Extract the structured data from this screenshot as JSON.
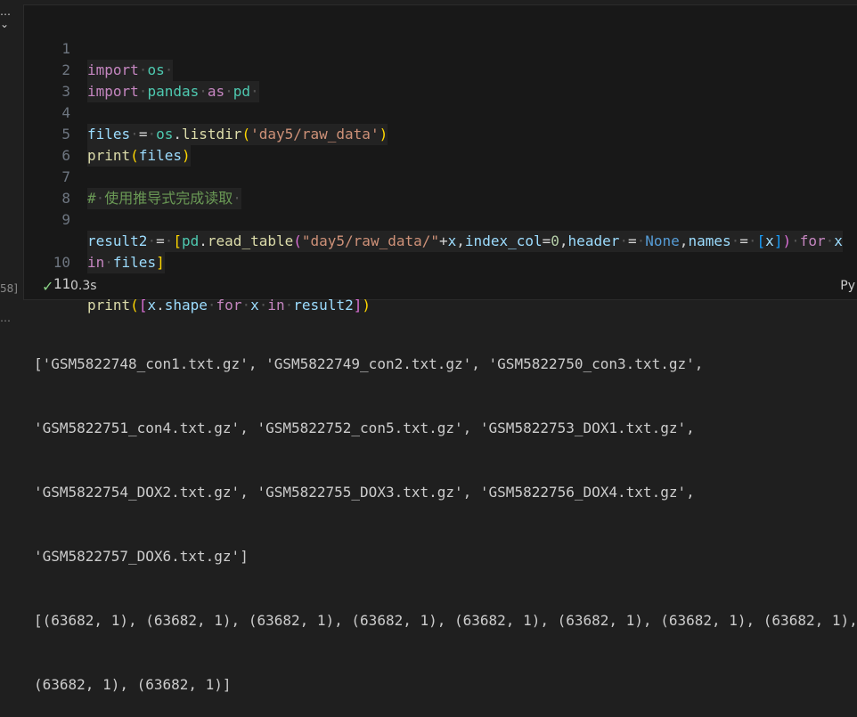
{
  "gutter": {
    "chevron": "… ⌄",
    "exec_count": "58]",
    "out_marker": "…"
  },
  "cell": {
    "lines": [
      {
        "n": "1",
        "text": "import os"
      },
      {
        "n": "2",
        "text": "import pandas as pd"
      },
      {
        "n": "3",
        "text": ""
      },
      {
        "n": "4",
        "text": "files = os.listdir('day5/raw_data')"
      },
      {
        "n": "5",
        "text": "print(files)"
      },
      {
        "n": "6",
        "text": ""
      },
      {
        "n": "7",
        "text": "# 使用推导式完成读取"
      },
      {
        "n": "8",
        "text": ""
      },
      {
        "n": "9",
        "text": "result2 = [pd.read_table(\"day5/raw_data/\"+x,index_col=0,header = None,names = [x]) for x"
      },
      {
        "n": "",
        "text": "in files]"
      },
      {
        "n": "10",
        "text": ""
      },
      {
        "n": "11",
        "text": "print([x.shape for x in result2])"
      }
    ],
    "status": {
      "time": "0.3s",
      "language": "Py"
    }
  },
  "output": {
    "lines": [
      "['GSM5822748_con1.txt.gz', 'GSM5822749_con2.txt.gz', 'GSM5822750_con3.txt.gz',",
      "'GSM5822751_con4.txt.gz', 'GSM5822752_con5.txt.gz', 'GSM5822753_DOX1.txt.gz',",
      "'GSM5822754_DOX2.txt.gz', 'GSM5822755_DOX3.txt.gz', 'GSM5822756_DOX4.txt.gz',",
      "'GSM5822757_DOX6.txt.gz']",
      "[(63682, 1), (63682, 1), (63682, 1), (63682, 1), (63682, 1), (63682, 1), (63682, 1), (63682, 1),",
      "(63682, 1), (63682, 1)]"
    ]
  },
  "colors": {
    "keyword": "#c586c0",
    "module": "#4ec9b0",
    "identifier": "#9cdcfe",
    "function": "#dcdcaa",
    "string": "#ce9178",
    "comment": "#6a9955",
    "success": "#89d185"
  },
  "icons": {
    "success": "check-icon"
  }
}
